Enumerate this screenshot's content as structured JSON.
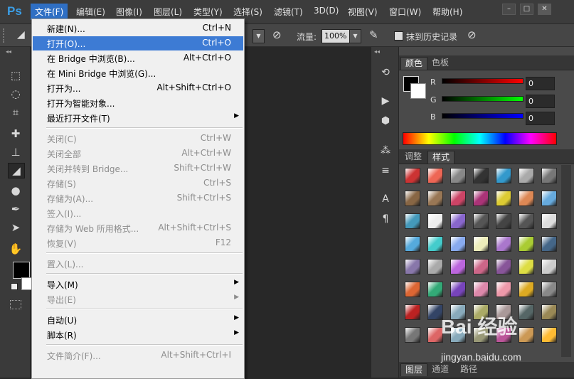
{
  "app": {
    "logo": "Ps"
  },
  "menubar": {
    "items": [
      "文件(F)",
      "编辑(E)",
      "图像(I)",
      "图层(L)",
      "类型(Y)",
      "选择(S)",
      "滤镜(T)",
      "3D(D)",
      "视图(V)",
      "窗口(W)",
      "帮助(H)"
    ],
    "window_buttons": [
      "–",
      "□",
      "✕"
    ]
  },
  "options_bar": {
    "flow_label": "流量:",
    "flow_value": "100%",
    "erase_history_label": "抹到历史记录"
  },
  "file_menu": {
    "items": [
      {
        "label": "新建(N)...",
        "shortcut": "Ctrl+N",
        "disabled": false
      },
      {
        "label": "打开(O)...",
        "shortcut": "Ctrl+O",
        "disabled": false,
        "highlighted": true
      },
      {
        "label": "在 Bridge 中浏览(B)...",
        "shortcut": "Alt+Ctrl+O",
        "disabled": false
      },
      {
        "label": "在 Mini Bridge 中浏览(G)...",
        "shortcut": "",
        "disabled": false
      },
      {
        "label": "打开为...",
        "shortcut": "Alt+Shift+Ctrl+O",
        "disabled": false
      },
      {
        "label": "打开为智能对象...",
        "shortcut": "",
        "disabled": false
      },
      {
        "label": "最近打开文件(T)",
        "shortcut": "",
        "disabled": false,
        "submenu": true
      },
      {
        "label": "关闭(C)",
        "shortcut": "Ctrl+W",
        "disabled": true
      },
      {
        "label": "关闭全部",
        "shortcut": "Alt+Ctrl+W",
        "disabled": true
      },
      {
        "label": "关闭并转到 Bridge...",
        "shortcut": "Shift+Ctrl+W",
        "disabled": true
      },
      {
        "label": "存储(S)",
        "shortcut": "Ctrl+S",
        "disabled": true
      },
      {
        "label": "存储为(A)...",
        "shortcut": "Shift+Ctrl+S",
        "disabled": true
      },
      {
        "label": "签入(I)...",
        "shortcut": "",
        "disabled": true
      },
      {
        "label": "存储为 Web 所用格式...",
        "shortcut": "Alt+Shift+Ctrl+S",
        "disabled": true
      },
      {
        "label": "恢复(V)",
        "shortcut": "F12",
        "disabled": true
      },
      {
        "label": "置入(L)...",
        "shortcut": "",
        "disabled": true
      },
      {
        "label": "导入(M)",
        "shortcut": "",
        "disabled": false,
        "submenu": true
      },
      {
        "label": "导出(E)",
        "shortcut": "",
        "disabled": true,
        "submenu": true
      },
      {
        "label": "自动(U)",
        "shortcut": "",
        "disabled": false,
        "submenu": true
      },
      {
        "label": "脚本(R)",
        "shortcut": "",
        "disabled": false,
        "submenu": true
      },
      {
        "label": "文件简介(F)...",
        "shortcut": "Alt+Shift+Ctrl+I",
        "disabled": true
      }
    ]
  },
  "color_panel": {
    "tabs": [
      "颜色",
      "色板"
    ],
    "channels": [
      {
        "label": "R",
        "value": "0",
        "color": "#ff0000"
      },
      {
        "label": "G",
        "value": "0",
        "color": "#00ff00"
      },
      {
        "label": "B",
        "value": "0",
        "color": "#0000ff"
      }
    ]
  },
  "styles_panel": {
    "tabs": [
      "调整",
      "样式"
    ]
  },
  "layers_panel": {
    "tabs": [
      "图层",
      "通道",
      "路径"
    ]
  },
  "watermark": {
    "text": "Bai 经验",
    "url": "jingyan.baidu.com"
  }
}
